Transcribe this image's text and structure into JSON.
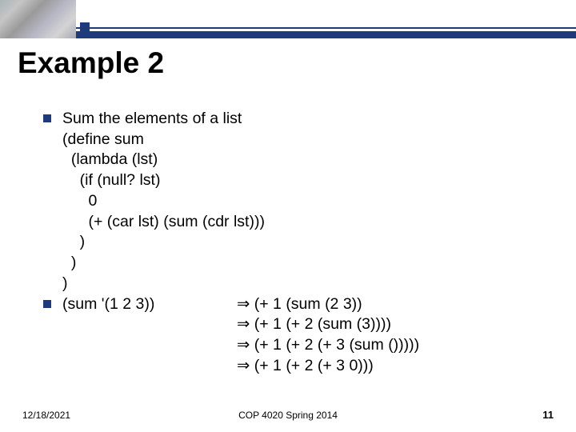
{
  "title": "Example 2",
  "bullet1": {
    "heading": "Sum the elements of a list",
    "code": "(define sum\n  (lambda (lst)\n    (if (null? lst)\n      0\n      (+ (car lst) (sum (cdr lst)))\n    )\n  )\n)"
  },
  "bullet2": {
    "call": "(sum '(1 2 3))",
    "steps": [
      "⇒ (+ 1 (sum (2 3))",
      "⇒ (+ 1 (+ 2 (sum (3))))",
      "⇒ (+ 1 (+ 2 (+ 3 (sum ()))))",
      "⇒ (+ 1 (+ 2 (+ 3 0)))"
    ]
  },
  "footer": {
    "date": "12/18/2021",
    "course": "COP 4020 Spring 2014",
    "page": "11"
  }
}
